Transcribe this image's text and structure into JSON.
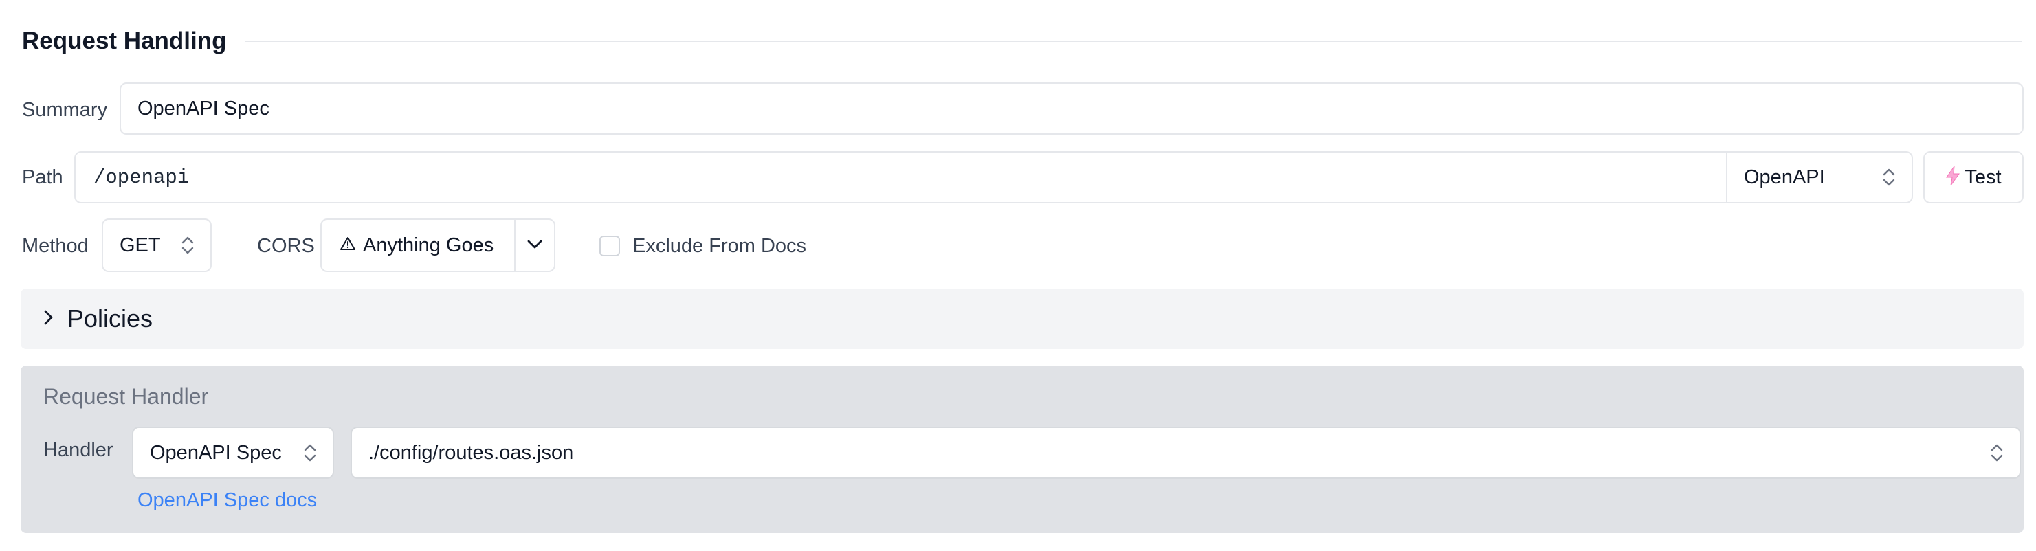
{
  "section": {
    "title": "Request Handling"
  },
  "summary": {
    "label": "Summary",
    "value": "OpenAPI Spec"
  },
  "path": {
    "label": "Path",
    "value": "/openapi",
    "type_value": "OpenAPI",
    "test_label": "Test"
  },
  "method": {
    "label": "Method",
    "value": "GET"
  },
  "cors": {
    "label": "CORS",
    "value": "Anything Goes"
  },
  "exclude_docs": {
    "label": "Exclude From Docs",
    "checked": false
  },
  "policies": {
    "title": "Policies"
  },
  "handler": {
    "title": "Request Handler",
    "label": "Handler",
    "type_value": "OpenAPI Spec",
    "path_value": "./config/routes.oas.json",
    "docs_link": "OpenAPI Spec docs"
  },
  "colors": {
    "link": "#3b82f6",
    "test_icon": "#f472b6",
    "panel_bg": "#e0e2e6",
    "policies_bg": "#f3f4f6"
  }
}
